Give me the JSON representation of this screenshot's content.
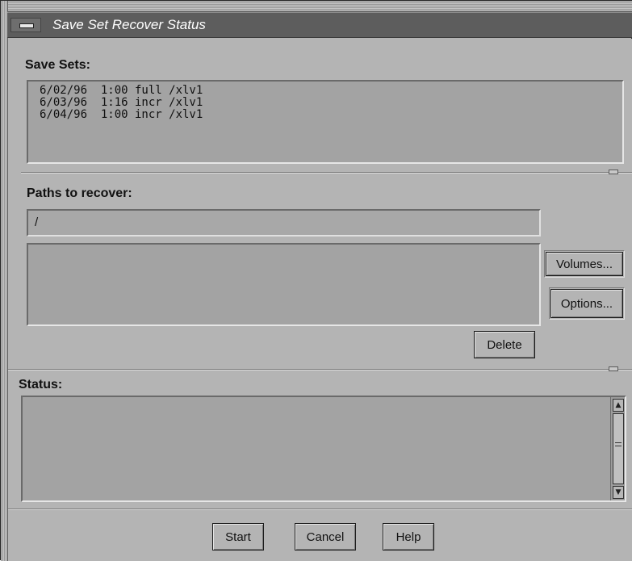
{
  "window": {
    "title": "Save Set Recover Status"
  },
  "save_sets": {
    "label": "Save Sets:",
    "items": [
      "6/02/96  1:00 full /xlv1",
      "6/03/96  1:16 incr /xlv1",
      "6/04/96  1:00 incr /xlv1"
    ]
  },
  "paths": {
    "label": "Paths to recover:",
    "input_value": "/",
    "volumes_button": "Volumes...",
    "options_button": "Options...",
    "delete_button": "Delete"
  },
  "status": {
    "label": "Status:"
  },
  "footer": {
    "start_button": "Start",
    "cancel_button": "Cancel",
    "help_button": "Help"
  }
}
